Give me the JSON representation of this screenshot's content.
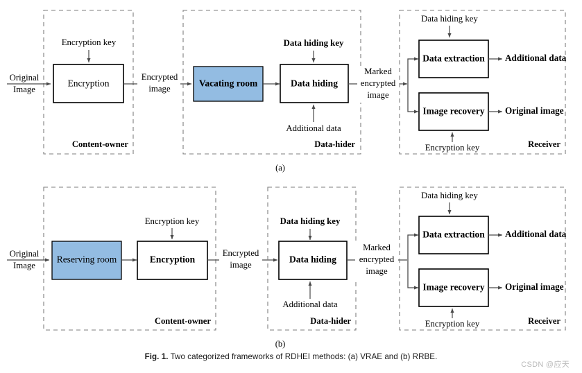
{
  "figure": {
    "caption_prefix": "Fig. 1.",
    "caption_text": "Two categorized frameworks of RDHEI methods: (a) VRAE and (b) RRBE.",
    "watermark": "CSDN @应天",
    "background_color": "#ffffff",
    "accent_blue": "#93bce2",
    "box_border_color": "#000000",
    "group_border_color": "#7d7d7d",
    "line_color": "#4a4a4a"
  },
  "panels": [
    {
      "id": "a",
      "sublabel": "(a)",
      "name": "VRAE",
      "groups": [
        {
          "id": "a-content-owner",
          "role_label": "Content-owner",
          "blocks": [
            {
              "id": "a-encryption",
              "label": "Encryption",
              "highlighted": false
            }
          ],
          "inputs": [
            {
              "id": "a-original-image",
              "label": "Original\nImage",
              "line1": "Original",
              "line2": "Image"
            },
            {
              "id": "a-encryption-key",
              "label": "Encryption key"
            }
          ]
        },
        {
          "id": "a-data-hider",
          "role_label": "Data-hider",
          "blocks": [
            {
              "id": "a-vacating-room",
              "label": "Vacating room",
              "highlighted": true
            },
            {
              "id": "a-data-hiding",
              "label": "Data hiding",
              "highlighted": false
            }
          ],
          "inputs": [
            {
              "id": "a-data-hiding-key",
              "label": "Data hiding key"
            },
            {
              "id": "a-additional-data-in",
              "label": "Additional data"
            }
          ]
        },
        {
          "id": "a-receiver",
          "role_label": "Receiver",
          "blocks": [
            {
              "id": "a-data-extraction",
              "label": "Data extraction",
              "highlighted": false
            },
            {
              "id": "a-image-recovery",
              "label": "Image recovery",
              "highlighted": false
            }
          ],
          "inputs": [
            {
              "id": "a-receiver-data-hiding-key",
              "label": "Data hiding key"
            },
            {
              "id": "a-receiver-encryption-key",
              "label": "Encryption key"
            }
          ],
          "outputs": [
            {
              "id": "a-additional-data-out",
              "label": "Additional data"
            },
            {
              "id": "a-original-image-out",
              "label": "Original image"
            }
          ]
        }
      ],
      "connectors": [
        {
          "id": "a-encrypted-image",
          "line1": "Encrypted",
          "line2": "image"
        },
        {
          "id": "a-marked-encrypted-image",
          "line1": "Marked",
          "line2": "encrypted",
          "line3": "image"
        }
      ]
    },
    {
      "id": "b",
      "sublabel": "(b)",
      "name": "RRBE",
      "groups": [
        {
          "id": "b-content-owner",
          "role_label": "Content-owner",
          "blocks": [
            {
              "id": "b-reserving-room",
              "label": "Reserving room",
              "highlighted": true
            },
            {
              "id": "b-encryption",
              "label": "Encryption",
              "highlighted": false
            }
          ],
          "inputs": [
            {
              "id": "b-original-image",
              "label": "Original\nImage",
              "line1": "Original",
              "line2": "Image"
            },
            {
              "id": "b-encryption-key",
              "label": "Encryption key"
            }
          ]
        },
        {
          "id": "b-data-hider",
          "role_label": "Data-hider",
          "blocks": [
            {
              "id": "b-data-hiding",
              "label": "Data hiding",
              "highlighted": false
            }
          ],
          "inputs": [
            {
              "id": "b-data-hiding-key",
              "label": "Data hiding key"
            },
            {
              "id": "b-additional-data-in",
              "label": "Additional data"
            }
          ]
        },
        {
          "id": "b-receiver",
          "role_label": "Receiver",
          "blocks": [
            {
              "id": "b-data-extraction",
              "label": "Data extraction",
              "highlighted": false
            },
            {
              "id": "b-image-recovery",
              "label": "Image recovery",
              "highlighted": false
            }
          ],
          "inputs": [
            {
              "id": "b-receiver-data-hiding-key",
              "label": "Data hiding key"
            },
            {
              "id": "b-receiver-encryption-key",
              "label": "Encryption key"
            }
          ],
          "outputs": [
            {
              "id": "b-additional-data-out",
              "label": "Additional data"
            },
            {
              "id": "b-original-image-out",
              "label": "Original image"
            }
          ]
        }
      ],
      "connectors": [
        {
          "id": "b-encrypted-image",
          "line1": "Encrypted",
          "line2": "image"
        },
        {
          "id": "b-marked-encrypted-image",
          "line1": "Marked",
          "line2": "encrypted",
          "line3": "image"
        }
      ]
    }
  ]
}
